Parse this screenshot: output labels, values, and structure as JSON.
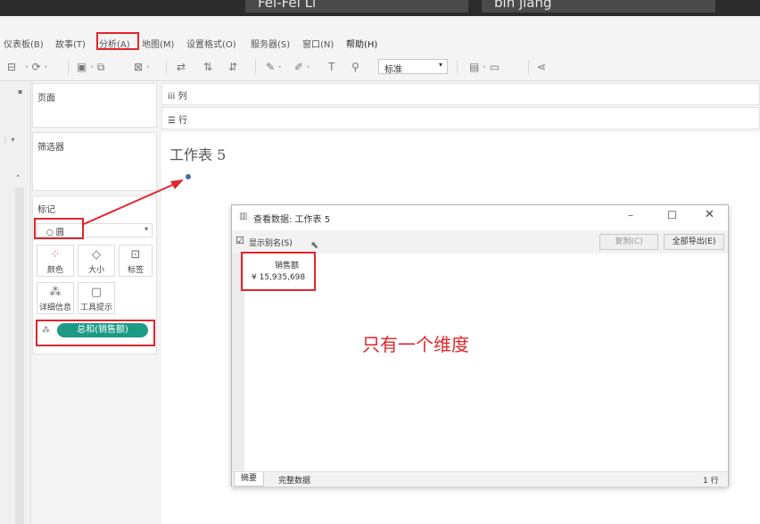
{
  "meeting": {
    "participant_1": "Fei-Fei Li",
    "participant_2": "bin jiang"
  },
  "menu": {
    "items": [
      "仪表板(B)",
      "故事(T)",
      "分析(A)",
      "地图(M)",
      "设置格式(O)",
      "服务器(S)",
      "窗口(N)",
      "帮助(H)"
    ]
  },
  "toolbar": {
    "fit_value": "标准"
  },
  "panels": {
    "pages_title": "页面",
    "filters_title": "筛选器",
    "marks_title": "标记",
    "mark_type": "○ 圆",
    "cards": {
      "color": "颜色",
      "size": "大小",
      "label": "标签",
      "detail": "详细信息",
      "tooltip": "工具提示"
    },
    "pill": "总和(销售额)"
  },
  "shelves": {
    "columns": "iii 列",
    "rows": "☰ 行"
  },
  "sheet": {
    "title": "工作表 5"
  },
  "dialog": {
    "title": "查看数据: 工作表 5",
    "show_alias_label": "显示别名(S)",
    "copy_button": "复制(C)",
    "export_all_button": "全部导出(E)",
    "column_header": "销售额",
    "cell_value": "¥ 15,935,698",
    "tab_summary": "摘要",
    "tab_full_data": "完整数据",
    "row_count": "1 行"
  },
  "annotation": "只有一个维度",
  "colors": {
    "accent_red": "#e0262b",
    "pill_green": "#1d9a86"
  }
}
